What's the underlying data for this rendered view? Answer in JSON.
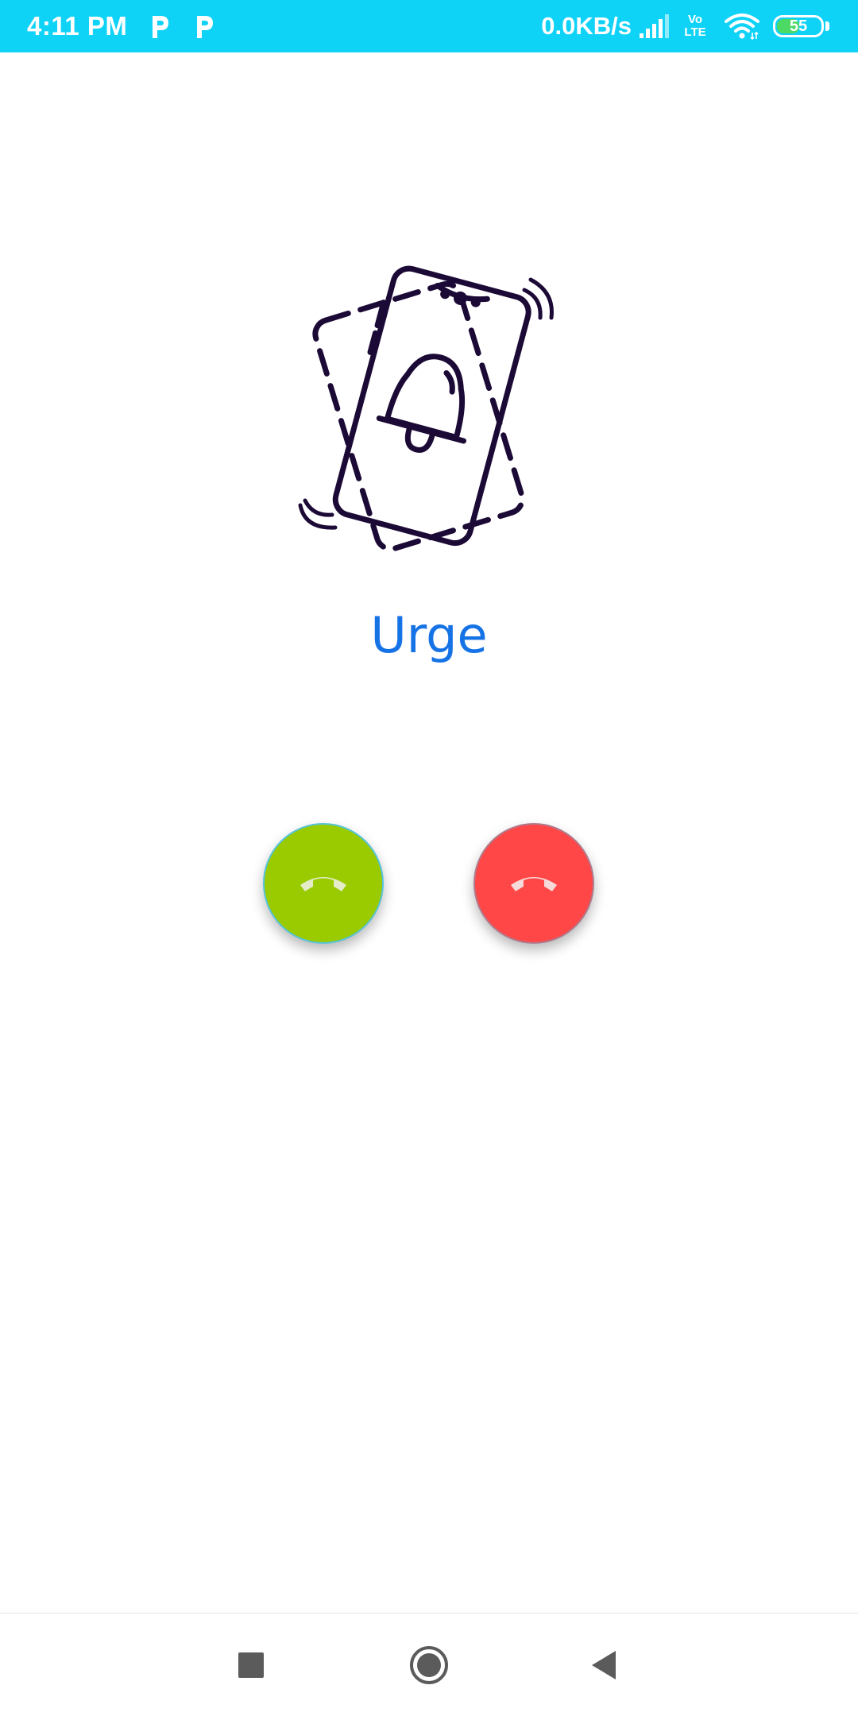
{
  "status_bar": {
    "time": "4:11 PM",
    "net_speed": "0.0KB/s",
    "volte_top": "Vo",
    "volte_bottom": "LTE",
    "battery": "55",
    "battery_level": 0.55,
    "bg_color": "#0fd2f7",
    "notification_icons": [
      "p-icon",
      "p-icon"
    ]
  },
  "app": {
    "title": "Urge",
    "illustration": "ringing-phone-bell-icon",
    "title_color": "#1673e6"
  },
  "call_actions": {
    "accept": {
      "icon": "phone-handset-icon",
      "color": "#9acb00"
    },
    "decline": {
      "icon": "phone-handset-icon",
      "color": "#ff4747"
    }
  },
  "nav_bar": {
    "buttons": [
      "recents-icon",
      "home-icon",
      "back-icon"
    ]
  }
}
